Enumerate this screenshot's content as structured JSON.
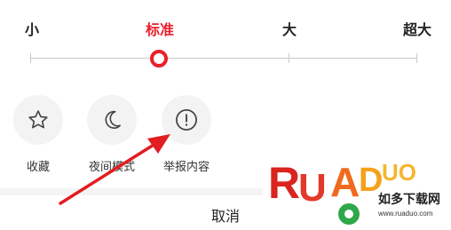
{
  "colors": {
    "accent": "#e8202a",
    "arrow": "#e11d22"
  },
  "font_size": {
    "options": [
      "小",
      "标准",
      "大",
      "超大"
    ],
    "selected": "标准",
    "selected_level": 1
  },
  "actions": [
    {
      "label": "收藏",
      "icon": "star-icon"
    },
    {
      "label": "夜间模式",
      "icon": "moon-icon"
    },
    {
      "label": "举报内容",
      "icon": "alert-icon"
    }
  ],
  "cancel_label": "取消",
  "watermark": {
    "brand": "RUANDUO",
    "text": "如多下载网",
    "url": "www.ruaduo.com"
  }
}
